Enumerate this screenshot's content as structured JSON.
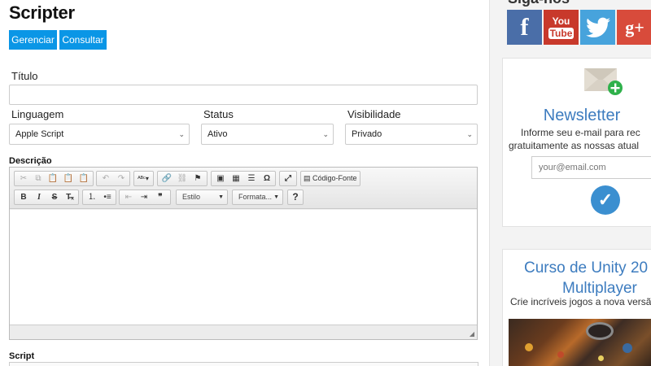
{
  "page": {
    "title": "Scripter"
  },
  "actions": {
    "manage": "Gerenciar",
    "view": "Consultar"
  },
  "form": {
    "title_label": "Título",
    "title_value": "",
    "language_label": "Linguagem",
    "language_value": "Apple Script",
    "status_label": "Status",
    "status_value": "Ativo",
    "visibility_label": "Visibilidade",
    "visibility_value": "Privado",
    "description_label": "Descrição",
    "script_label": "Script"
  },
  "editor": {
    "row1_icons": [
      "cut-icon",
      "copy-icon",
      "paste-icon",
      "paste-text-icon",
      "paste-word-icon",
      "undo-icon",
      "redo-icon",
      "spellcheck-icon",
      "link-icon",
      "unlink-icon",
      "anchor-icon",
      "image-icon",
      "table-icon",
      "horizontal-rule-icon",
      "special-char-icon",
      "maximize-icon",
      "source-icon"
    ],
    "source_label": "Código-Fonte",
    "style_label": "Estilo",
    "format_label": "Formata...",
    "row2_icons": [
      "bold-icon",
      "italic-icon",
      "strike-icon",
      "remove-format-icon",
      "numbered-list-icon",
      "bulleted-list-icon",
      "outdent-icon",
      "indent-icon",
      "blockquote-icon",
      "help-icon"
    ]
  },
  "sidebar": {
    "social_title": "Siga-nos",
    "social": [
      {
        "name": "facebook",
        "glyph": "f",
        "color": "#4a6ea8"
      },
      {
        "name": "youtube",
        "glyph_top": "You",
        "glyph_bottom": "Tube",
        "color": "#c8392b"
      },
      {
        "name": "twitter",
        "glyph": "🐦",
        "color": "#47a3dc"
      },
      {
        "name": "google-plus",
        "glyph": "g+",
        "color": "#d84b3b"
      }
    ],
    "newsletter": {
      "title": "Newsletter",
      "subtitle_line1": "Informe seu e-mail para rec",
      "subtitle_line2": "gratuitamente as nossas atual",
      "email_placeholder": "your@email.com"
    },
    "course": {
      "title_line1": "Curso de Unity 20",
      "title_line2": "Multiplayer",
      "subtitle": "Crie incríveis jogos a nova versã"
    }
  },
  "colors": {
    "primary_button": "#0a96e6",
    "accent_blue": "#3d7cbf",
    "check_button": "#3b8fd0"
  }
}
